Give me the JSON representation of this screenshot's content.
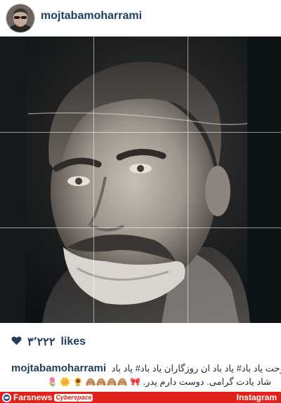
{
  "post": {
    "username": "mojtabamoharrami",
    "likes_count": "۳٬۲۲۲",
    "likes_suffix": "likes",
    "caption_user": "mojtabamoharrami",
    "caption_line1": "#روحت یاد باد# یاد باد ان روزگاران یاد باد# یاد باد",
    "caption_line2": "شاد یادت گرامی. دوست دارم پدر.",
    "caption_emojis": "🌷 🌼 🌻 🙈🙈🙈🙈 🎀"
  },
  "footer": {
    "source_label": "Farsnews",
    "source_badge": "Cyberspace",
    "platform_label": "Instagram"
  },
  "colors": {
    "username": "#1f3d5e",
    "heart": "#1f3d5e",
    "bottom_bar": "#e2231a"
  },
  "icons": {
    "heart": "heart-icon",
    "avatar": "avatar",
    "farsnews_logo": "farsnews-logo-icon"
  }
}
